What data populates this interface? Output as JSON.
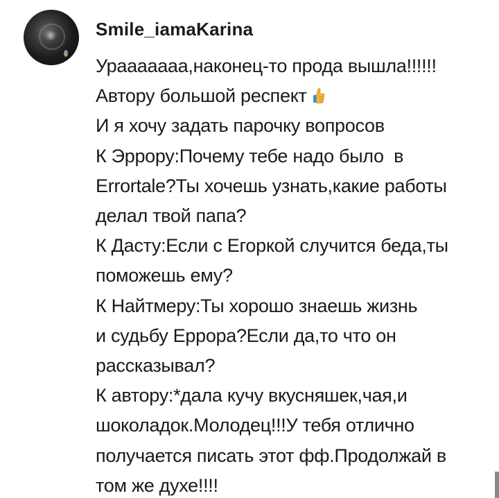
{
  "comment": {
    "avatar_icon": "user-avatar-dark-photo",
    "username": "Smile_iamaKarina",
    "lines": [
      "Урааааааа,наконец-то прода вышла!!!!!!",
      "Автору большой респект",
      "И я хочу задать парочку вопросов",
      "К Эррору:Почему тебе надо было  в",
      "Errortale?Ты хочешь узнать,какие работы",
      "делал твой папа?",
      "К Дасту:Если с Егоркой случится беда,ты",
      "поможешь ему?",
      "К Найтмеру:Ты хорошо знаешь жизнь",
      "и судьбу Еррора?Если да,то что он",
      "рассказывал?",
      "К автору:*дала кучу вкусняшек,чая,и",
      "шоколадок.Молодец!!!У тебя отлично",
      "получается писать этот фф.Продолжай в",
      "том же духе!!!!"
    ],
    "emoji_icon": "thumbs-up-icon",
    "colors": {
      "text": "#1a1a1a",
      "emoji_fill": "#f4b33c",
      "emoji_cuff": "#3b8fd9"
    }
  }
}
